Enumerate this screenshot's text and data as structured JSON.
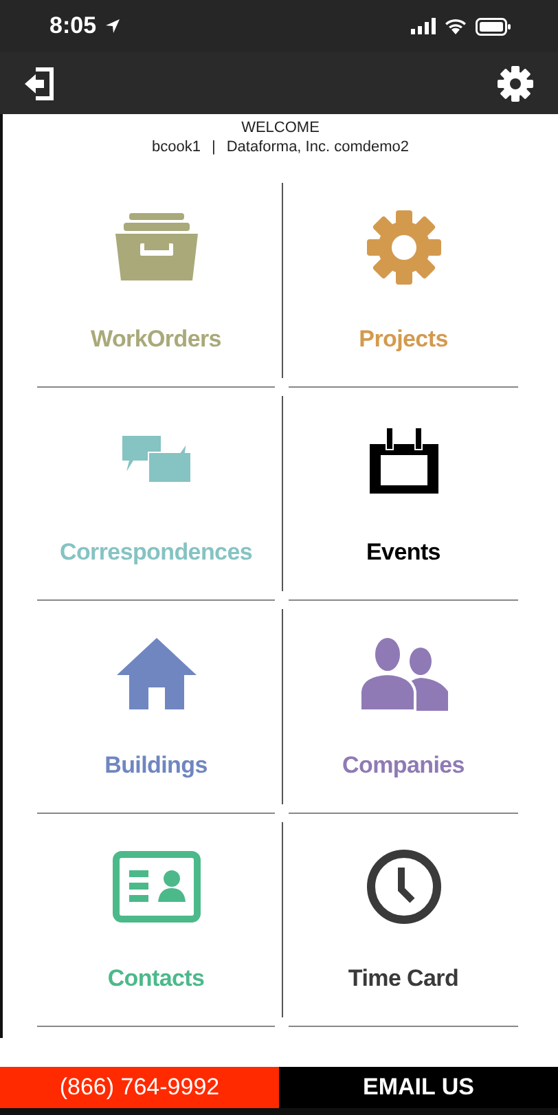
{
  "status_bar": {
    "time": "8:05"
  },
  "welcome": {
    "title": "WELCOME",
    "user": "bcook1",
    "separator": "|",
    "company": "Dataforma, Inc. comdemo2"
  },
  "tiles": [
    {
      "label": "WorkOrders",
      "kind": "drawer",
      "color": "#a9a97a"
    },
    {
      "label": "Projects",
      "kind": "gear",
      "color": "#d39a4e"
    },
    {
      "label": "Correspondences",
      "kind": "chat",
      "color": "#86c3c3"
    },
    {
      "label": "Events",
      "kind": "calendar",
      "color": "#000000"
    },
    {
      "label": "Buildings",
      "kind": "house",
      "color": "#6f86c0"
    },
    {
      "label": "Companies",
      "kind": "people",
      "color": "#8f7ab5"
    },
    {
      "label": "Contacts",
      "kind": "card",
      "color": "#4cb98a"
    },
    {
      "label": "Time Card",
      "kind": "clock",
      "color": "#3a3a3a"
    }
  ],
  "footer": {
    "phone": "(866) 764-9992",
    "email": "EMAIL US"
  }
}
